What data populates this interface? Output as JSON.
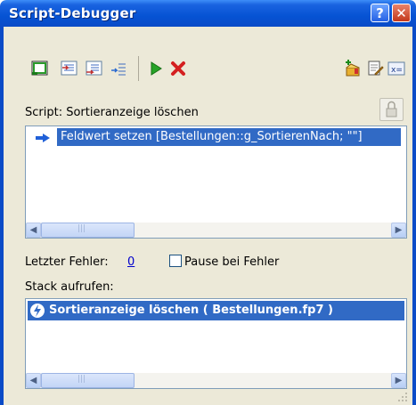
{
  "window": {
    "title": "Script-Debugger",
    "help_label": "?",
    "close_label": "✕"
  },
  "toolbar": {
    "buttons": [
      {
        "name": "step-over-button",
        "icon": "step-over-icon"
      },
      {
        "name": "step-into-button",
        "icon": "step-into-icon"
      },
      {
        "name": "step-out-button",
        "icon": "step-out-icon"
      },
      {
        "name": "set-next-step-button",
        "icon": "set-next-step-icon"
      },
      {
        "name": "run-button",
        "icon": "play-icon"
      },
      {
        "name": "halt-button",
        "icon": "stop-x-icon"
      },
      {
        "name": "set-breakpoint-button",
        "icon": "breakpoint-icon"
      },
      {
        "name": "edit-script-button",
        "icon": "edit-script-icon"
      },
      {
        "name": "data-viewer-button",
        "icon": "data-viewer-icon"
      }
    ]
  },
  "script_section": {
    "label": "Script: Sortieranzeige löschen",
    "lines": [
      "Feldwert setzen [Bestellungen::g_SortierenNach; \"\"]"
    ],
    "scroll_track_label": "|||"
  },
  "error_section": {
    "last_error_label": "Letzter Fehler:",
    "last_error_value": "0",
    "pause_on_error_label": "Pause bei Fehler",
    "pause_on_error_checked": false
  },
  "stack_section": {
    "label": "Stack aufrufen:",
    "items": [
      "Sortieranzeige löschen ( Bestellungen.fp7 )"
    ],
    "scroll_track_label": "|||"
  },
  "colors": {
    "titlebar": "#0a4bc7",
    "selection": "#316ac5",
    "window_bg": "#ece9d8"
  }
}
